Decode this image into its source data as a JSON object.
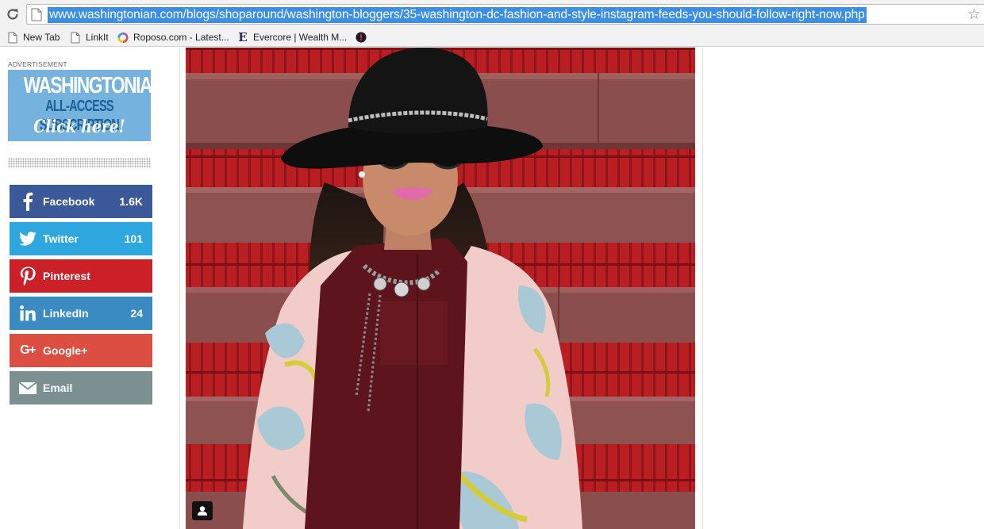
{
  "browser": {
    "url": "www.washingtonian.com/blogs/shoparound/washington-bloggers/35-washington-dc-fashion-and-style-instagram-feeds-you-should-follow-right-now.php",
    "bookmarks": [
      {
        "label": "New Tab",
        "icon": "page-icon"
      },
      {
        "label": "LinkIt",
        "icon": "page-icon"
      },
      {
        "label": "Roposo.com - Latest...",
        "icon": "roposo-icon"
      },
      {
        "label": "Evercore | Wealth M...",
        "icon": "evercore-icon"
      },
      {
        "label": "",
        "icon": "bookmark-favicon-icon"
      }
    ]
  },
  "sidebar": {
    "ad_label": "ADVERTISEMENT",
    "ad": {
      "line1": "WASHINGTONIAN",
      "line2": "ALL-ACCESS SUBSCRIPTION",
      "line3": "Click here!"
    },
    "share": [
      {
        "label": "Facebook",
        "count": "1.6K",
        "icon": "facebook-icon",
        "color": "#3b5998"
      },
      {
        "label": "Twitter",
        "count": "101",
        "icon": "twitter-icon",
        "color": "#2ea7de"
      },
      {
        "label": "Pinterest",
        "count": "",
        "icon": "pinterest-icon",
        "color": "#cb2027"
      },
      {
        "label": "LinkedIn",
        "count": "24",
        "icon": "linkedin-icon",
        "color": "#3a8bc2"
      },
      {
        "label": "Google+",
        "count": "",
        "icon": "google-plus-icon",
        "color": "#dc4e41"
      },
      {
        "label": "Email",
        "count": "",
        "icon": "email-icon",
        "color": "#7a9091"
      }
    ]
  },
  "colors": {
    "url_highlight": "#3b8ee4",
    "ad_background": "#75b2dd"
  }
}
